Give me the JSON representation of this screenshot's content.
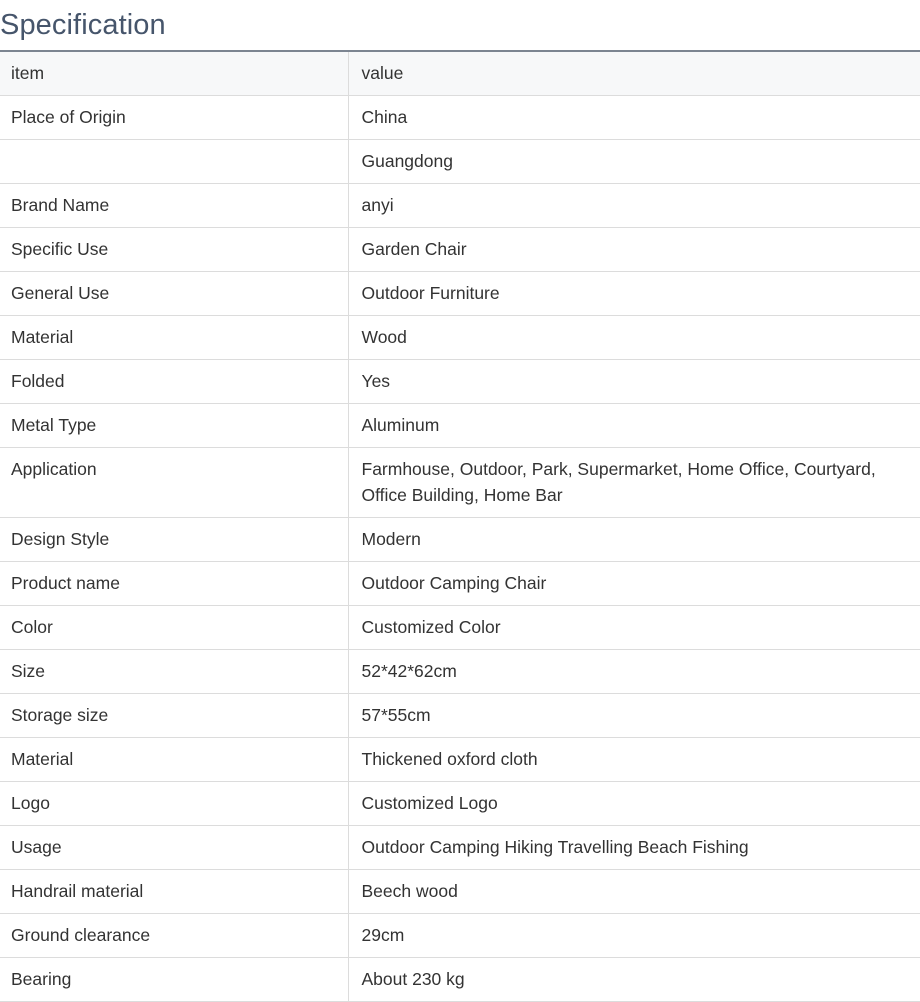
{
  "title": "Specification",
  "columns": [
    "item",
    "value"
  ],
  "rows": [
    {
      "item": "Place of Origin",
      "value": "China"
    },
    {
      "item": "",
      "value": "Guangdong"
    },
    {
      "item": "Brand Name",
      "value": "anyi"
    },
    {
      "item": "Specific Use",
      "value": "Garden Chair"
    },
    {
      "item": "General Use",
      "value": "Outdoor Furniture"
    },
    {
      "item": "Material",
      "value": "Wood"
    },
    {
      "item": "Folded",
      "value": "Yes"
    },
    {
      "item": "Metal Type",
      "value": "Aluminum"
    },
    {
      "item": "Application",
      "value": "Farmhouse, Outdoor, Park, Supermarket, Home Office, Courtyard, Office Building, Home Bar"
    },
    {
      "item": "Design Style",
      "value": "Modern"
    },
    {
      "item": "Product name",
      "value": "Outdoor Camping Chair"
    },
    {
      "item": "Color",
      "value": "Customized Color"
    },
    {
      "item": "Size",
      "value": "52*42*62cm"
    },
    {
      "item": "Storage size",
      "value": "57*55cm"
    },
    {
      "item": "Material",
      "value": "Thickened oxford cloth"
    },
    {
      "item": "Logo",
      "value": "Customized Logo"
    },
    {
      "item": "Usage",
      "value": "Outdoor Camping Hiking Travelling Beach Fishing"
    },
    {
      "item": "Handrail material",
      "value": "Beech wood"
    },
    {
      "item": "Ground clearance",
      "value": "29cm"
    },
    {
      "item": "Bearing",
      "value": "About 230 kg"
    }
  ]
}
